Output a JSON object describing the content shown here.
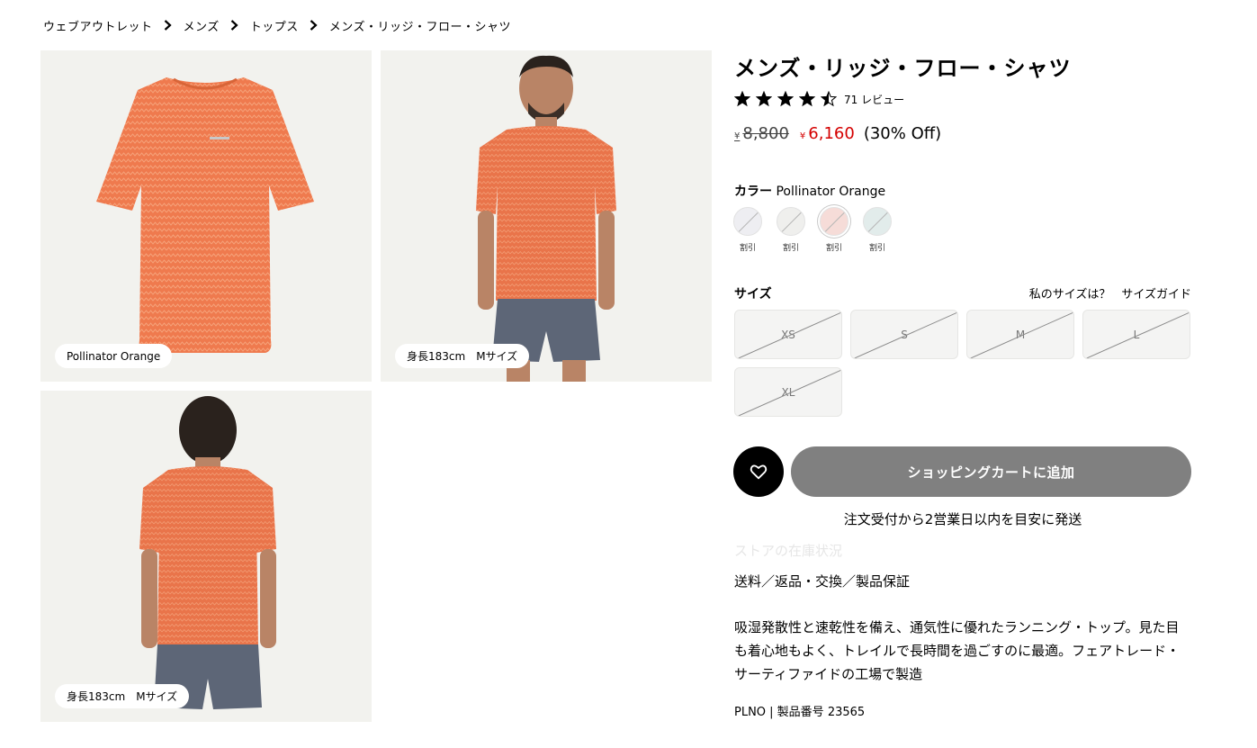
{
  "breadcrumb": {
    "items": [
      "ウェブアウトレット",
      "メンズ",
      "トップス",
      "メンズ・リッジ・フロー・シャツ"
    ]
  },
  "gallery": {
    "tiles": [
      {
        "label": "Pollinator Orange"
      },
      {
        "label": "身長183cm　Mサイズ"
      },
      {
        "label": "身長183cm　Mサイズ"
      }
    ]
  },
  "product": {
    "title": "メンズ・リッジ・フロー・シャツ",
    "rating_value": 4.5,
    "rating_max": 5,
    "review_count": "71 レビュー",
    "currency_symbol": "¥",
    "original_price": "8,800",
    "sale_price": "6,160",
    "discount": "(30% Off)",
    "sale_color": "#d40000"
  },
  "color": {
    "label": "カラー",
    "selected": "Pollinator Orange",
    "swatches": [
      {
        "tag": "割引",
        "fill": "#eeeef2",
        "selected": false
      },
      {
        "tag": "割引",
        "fill": "#efefed",
        "selected": false
      },
      {
        "tag": "割引",
        "fill": "#f6dcd8",
        "selected": true
      },
      {
        "tag": "割引",
        "fill": "#e2eceb",
        "selected": false
      }
    ]
  },
  "size": {
    "label": "サイズ",
    "my_size_link": "私のサイズは？",
    "guide_link": "サイズガイド",
    "options": [
      "XS",
      "S",
      "M",
      "L",
      "XL"
    ]
  },
  "actions": {
    "wishlist_icon": "heart-icon",
    "add_to_cart": "ショッピングカートに追加",
    "cart_color": "#808080"
  },
  "shipping_note": "注文受付から2営業日以内を目安に発送",
  "store_stock": "ストアの在庫状況",
  "policy_link": "送料／返品・交換／製品保証",
  "description": "吸湿発散性と速乾性を備え、通気性に優れたランニング・トップ。見た目も着心地もよく、トレイルで長時間を過ごすのに最適。フェアトレード・サーティファイドの工場で製造",
  "sku": "PLNO | 製品番号 23565"
}
